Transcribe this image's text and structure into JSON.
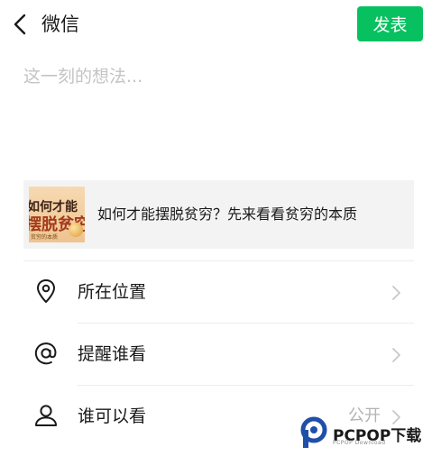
{
  "header": {
    "back_icon": "chevron-left-icon",
    "title": "微信",
    "publish_label": "发表"
  },
  "compose": {
    "placeholder": "这一刻的想法...",
    "value": ""
  },
  "shared_link": {
    "thumbnail": {
      "top_text": "",
      "line1": "如何才能",
      "line2": "摆脱贫穷",
      "bottom_text": "贫穷的本质"
    },
    "title": "如何才能摆脱贫穷？先来看看贫穷的本质"
  },
  "options": [
    {
      "icon": "location-pin-icon",
      "label": "所在位置",
      "value": ""
    },
    {
      "icon": "at-sign-icon",
      "label": "提醒谁看",
      "value": ""
    },
    {
      "icon": "person-icon",
      "label": "谁可以看",
      "value": "公开"
    }
  ],
  "watermark": {
    "text": "PCPOP下载",
    "sub": "PCPOP Download"
  },
  "colors": {
    "accent": "#07c160",
    "card_background": "#f3f3f3",
    "placeholder": "#c4c4c4",
    "secondary_text": "#b3b3b3",
    "watermark_blue": "#1f4fa8"
  }
}
